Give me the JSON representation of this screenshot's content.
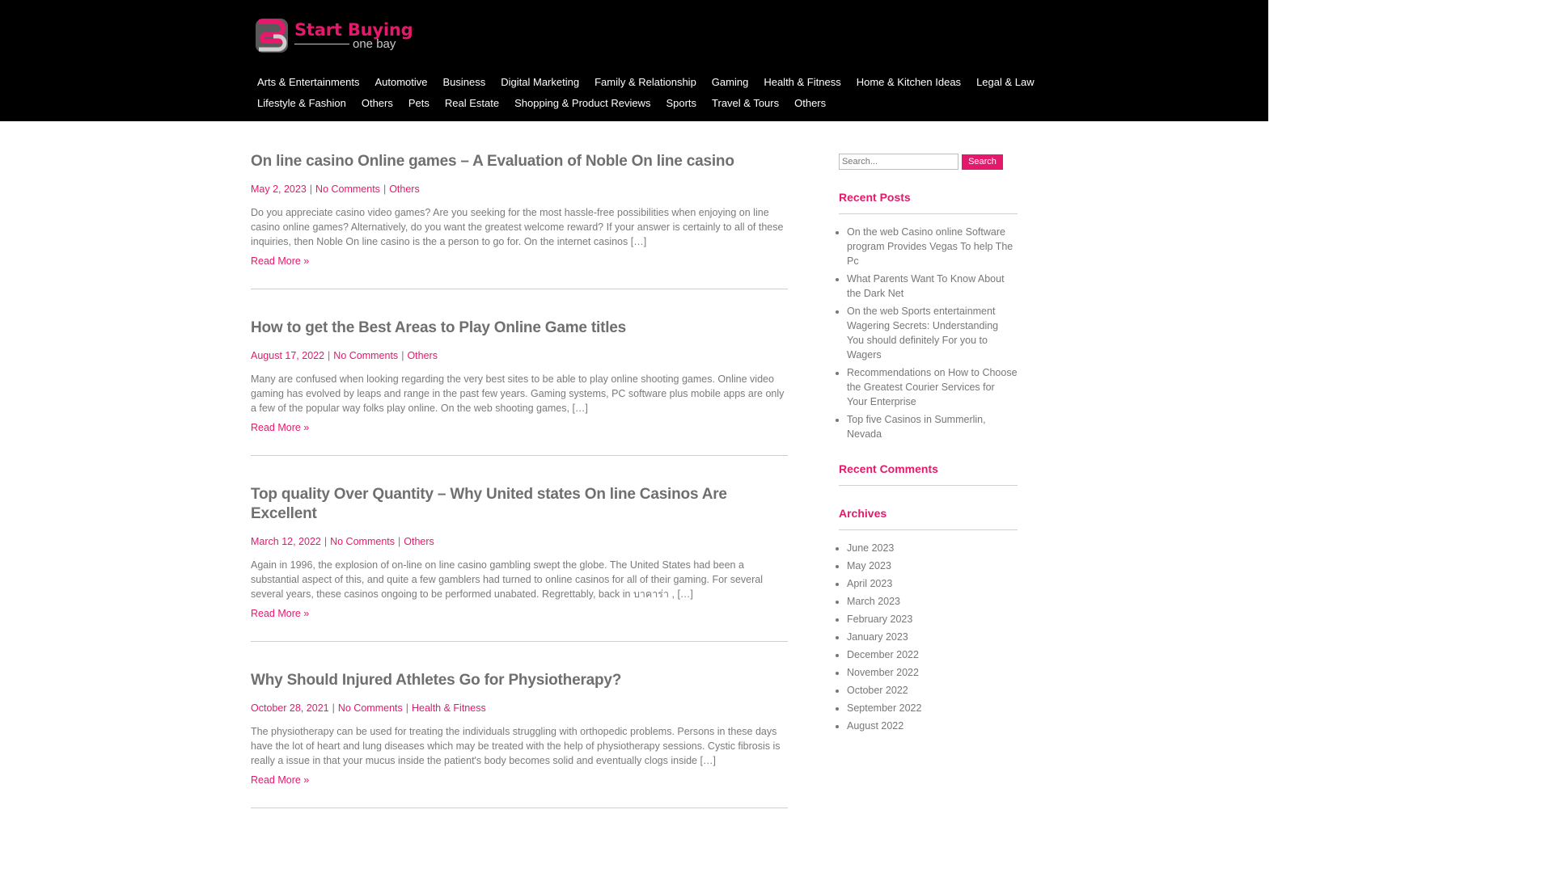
{
  "brand": {
    "title": "Start Buying",
    "subtitle": "one bay",
    "logo_letters": "SB",
    "accent_color": "#e5196b"
  },
  "nav": {
    "row1": [
      "Arts & Entertainments",
      "Automotive",
      "Business",
      "Digital Marketing",
      "Family & Relationship",
      "Gaming",
      "Health & Fitness",
      "Home & Kitchen Ideas",
      "Legal & Law"
    ],
    "row2": [
      "Lifestyle & Fashion",
      "Others",
      "Pets",
      "Real Estate",
      "Shopping & Product Reviews",
      "Sports",
      "Travel & Tours",
      "Others"
    ]
  },
  "posts": [
    {
      "title": "On line casino Online games – A Evaluation of Noble On line casino",
      "date": "May 2, 2023",
      "comments": "No Comments",
      "category": "Others",
      "excerpt": "Do you appreciate casino video games? Are you seeking for the most hassle-free possibilities when enjoying on line casino online games? Alternatively, do you want the greatest welcome reward? If your answer is certainly to all of these inquiries, then Noble On line casino is the a person to go for. On the internet casinos […]",
      "read_more": "Read More »"
    },
    {
      "title": "How to get the Best Areas to Play Online Game titles",
      "date": "August 17, 2022",
      "comments": "No Comments",
      "category": "Others",
      "excerpt": "Many are confused when looking regarding the very best sites to be able to play online shooting games. Online video gaming has evolved by leaps and range in the past few years. Gaming systems, PC software plus mobile apps are only a few of the popular way folks play online. On the web shooting games, […]",
      "read_more": "Read More »"
    },
    {
      "title": "Top quality Over Quantity – Why United states On line Casinos Are Excellent",
      "date": "March 12, 2022",
      "comments": "No Comments",
      "category": "Others",
      "excerpt": "Again in 1996, the explosion of on-line on line casino gambling swept the globe. The United States had been a substantial aspect of this, and quite a few gamblers had turned to online casinos for all of their gaming. For several several years, these casinos ongoing to be performed unabated. Regrettably, back in บาคาร่า , […]",
      "read_more": "Read More »"
    },
    {
      "title": "Why Should Injured Athletes Go for Physiotherapy?",
      "date": "October 28, 2021",
      "comments": "No Comments",
      "category": "Health & Fitness",
      "excerpt": "The physiotherapy can be used for treating the individuals struggling with orthopedic problems. Persons in these days have the lot of heart and lung diseases which may be treated with the help of physiotherapy sessions. Cystic fibrosis is really a issue in that your mucus inside the patient's body becomes solid and eventually clogs inside […]",
      "read_more": "Read More »"
    }
  ],
  "sidebar": {
    "search_placeholder": "Search...",
    "search_button": "Search",
    "recent_posts_title": "Recent Posts",
    "recent_posts": [
      "On the web Casino online Software program Provides Vegas To help The Pc",
      "What Parents Want To Know About the Dark Net",
      "On the web Sports entertainment Wagering Secrets: Understanding You should definitely For you to Wagers",
      "Recommendations on How to Choose the Greatest Courier Services for Your Enterprise",
      "Top five Casinos in Summerlin, Nevada"
    ],
    "recent_comments_title": "Recent Comments",
    "archives_title": "Archives",
    "archives": [
      "June 2023",
      "May 2023",
      "April 2023",
      "March 2023",
      "February 2023",
      "January 2023",
      "December 2022",
      "November 2022",
      "October 2022",
      "September 2022",
      "August 2022"
    ]
  }
}
